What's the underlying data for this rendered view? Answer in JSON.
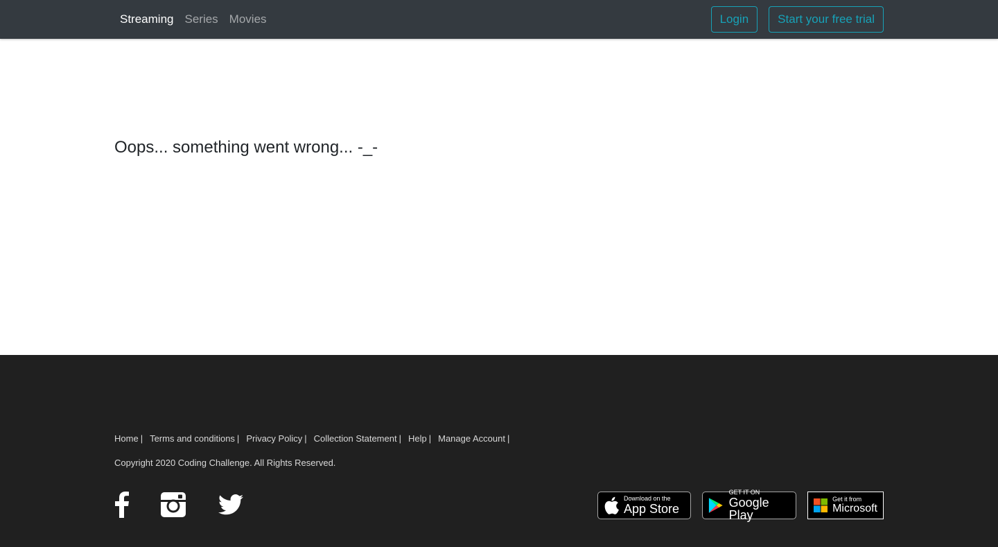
{
  "nav": {
    "brand": "Streaming",
    "links": [
      "Series",
      "Movies"
    ],
    "login_label": "Login",
    "trial_label": "Start your free trial"
  },
  "main": {
    "error_message": "Oops... something went wrong... -_-"
  },
  "footer": {
    "links": [
      "Home",
      "Terms and conditions",
      "Privacy Policy",
      "Collection Statement",
      "Help",
      "Manage Account"
    ],
    "separator": "|",
    "copyright": "Copyright 2020 Coding Challenge. All Rights Reserved.",
    "social_icons": [
      "facebook-icon",
      "instagram-icon",
      "twitter-icon"
    ],
    "stores": {
      "apple_small": "Download on the",
      "apple_big": "App Store",
      "google_small": "GET IT ON",
      "google_big": "Google Play",
      "ms_small": "Get it from",
      "ms_big": "Microsoft"
    }
  },
  "colors": {
    "navbar_bg": "#343a40",
    "accent": "#17a2b8",
    "footer_bg": "#202020"
  }
}
